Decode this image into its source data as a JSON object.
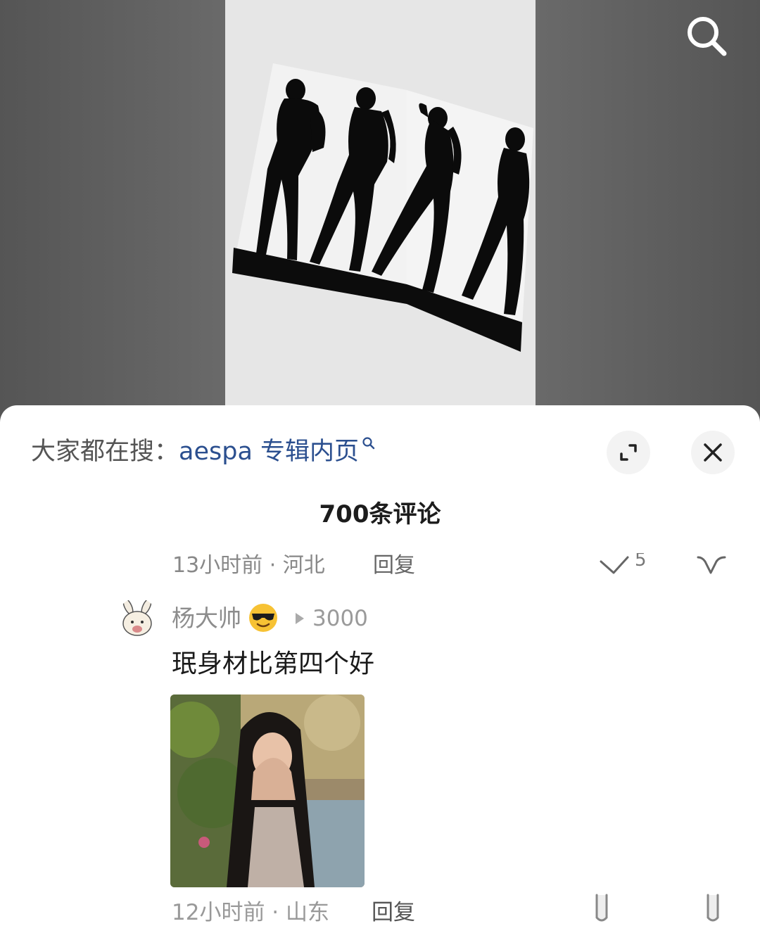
{
  "icons": {
    "search": "search-icon",
    "expand": "expand-icon",
    "close": "close-icon",
    "query_search": "search-icon",
    "play": "play-icon",
    "like": "thumb-up-icon",
    "dislike": "thumb-down-icon",
    "emoji": "sunglasses-emoji-icon"
  },
  "colors": {
    "query_link": "#2b4f8f",
    "sheet_bg": "#ffffff",
    "video_bg": "#606060"
  },
  "sheet": {
    "suggest_prefix": "大家都在搜：",
    "suggest_query": "aespa 专辑内页",
    "comment_count_label": "700条评论"
  },
  "previous_comment": {
    "meta": "13小时前 · 河北",
    "reply_label": "回复",
    "like_count": "5"
  },
  "comment": {
    "username": "杨大帅",
    "level": "3000",
    "text": "珉身材比第四个好",
    "meta": "12小时前 · 山东",
    "reply_label": "回复"
  }
}
